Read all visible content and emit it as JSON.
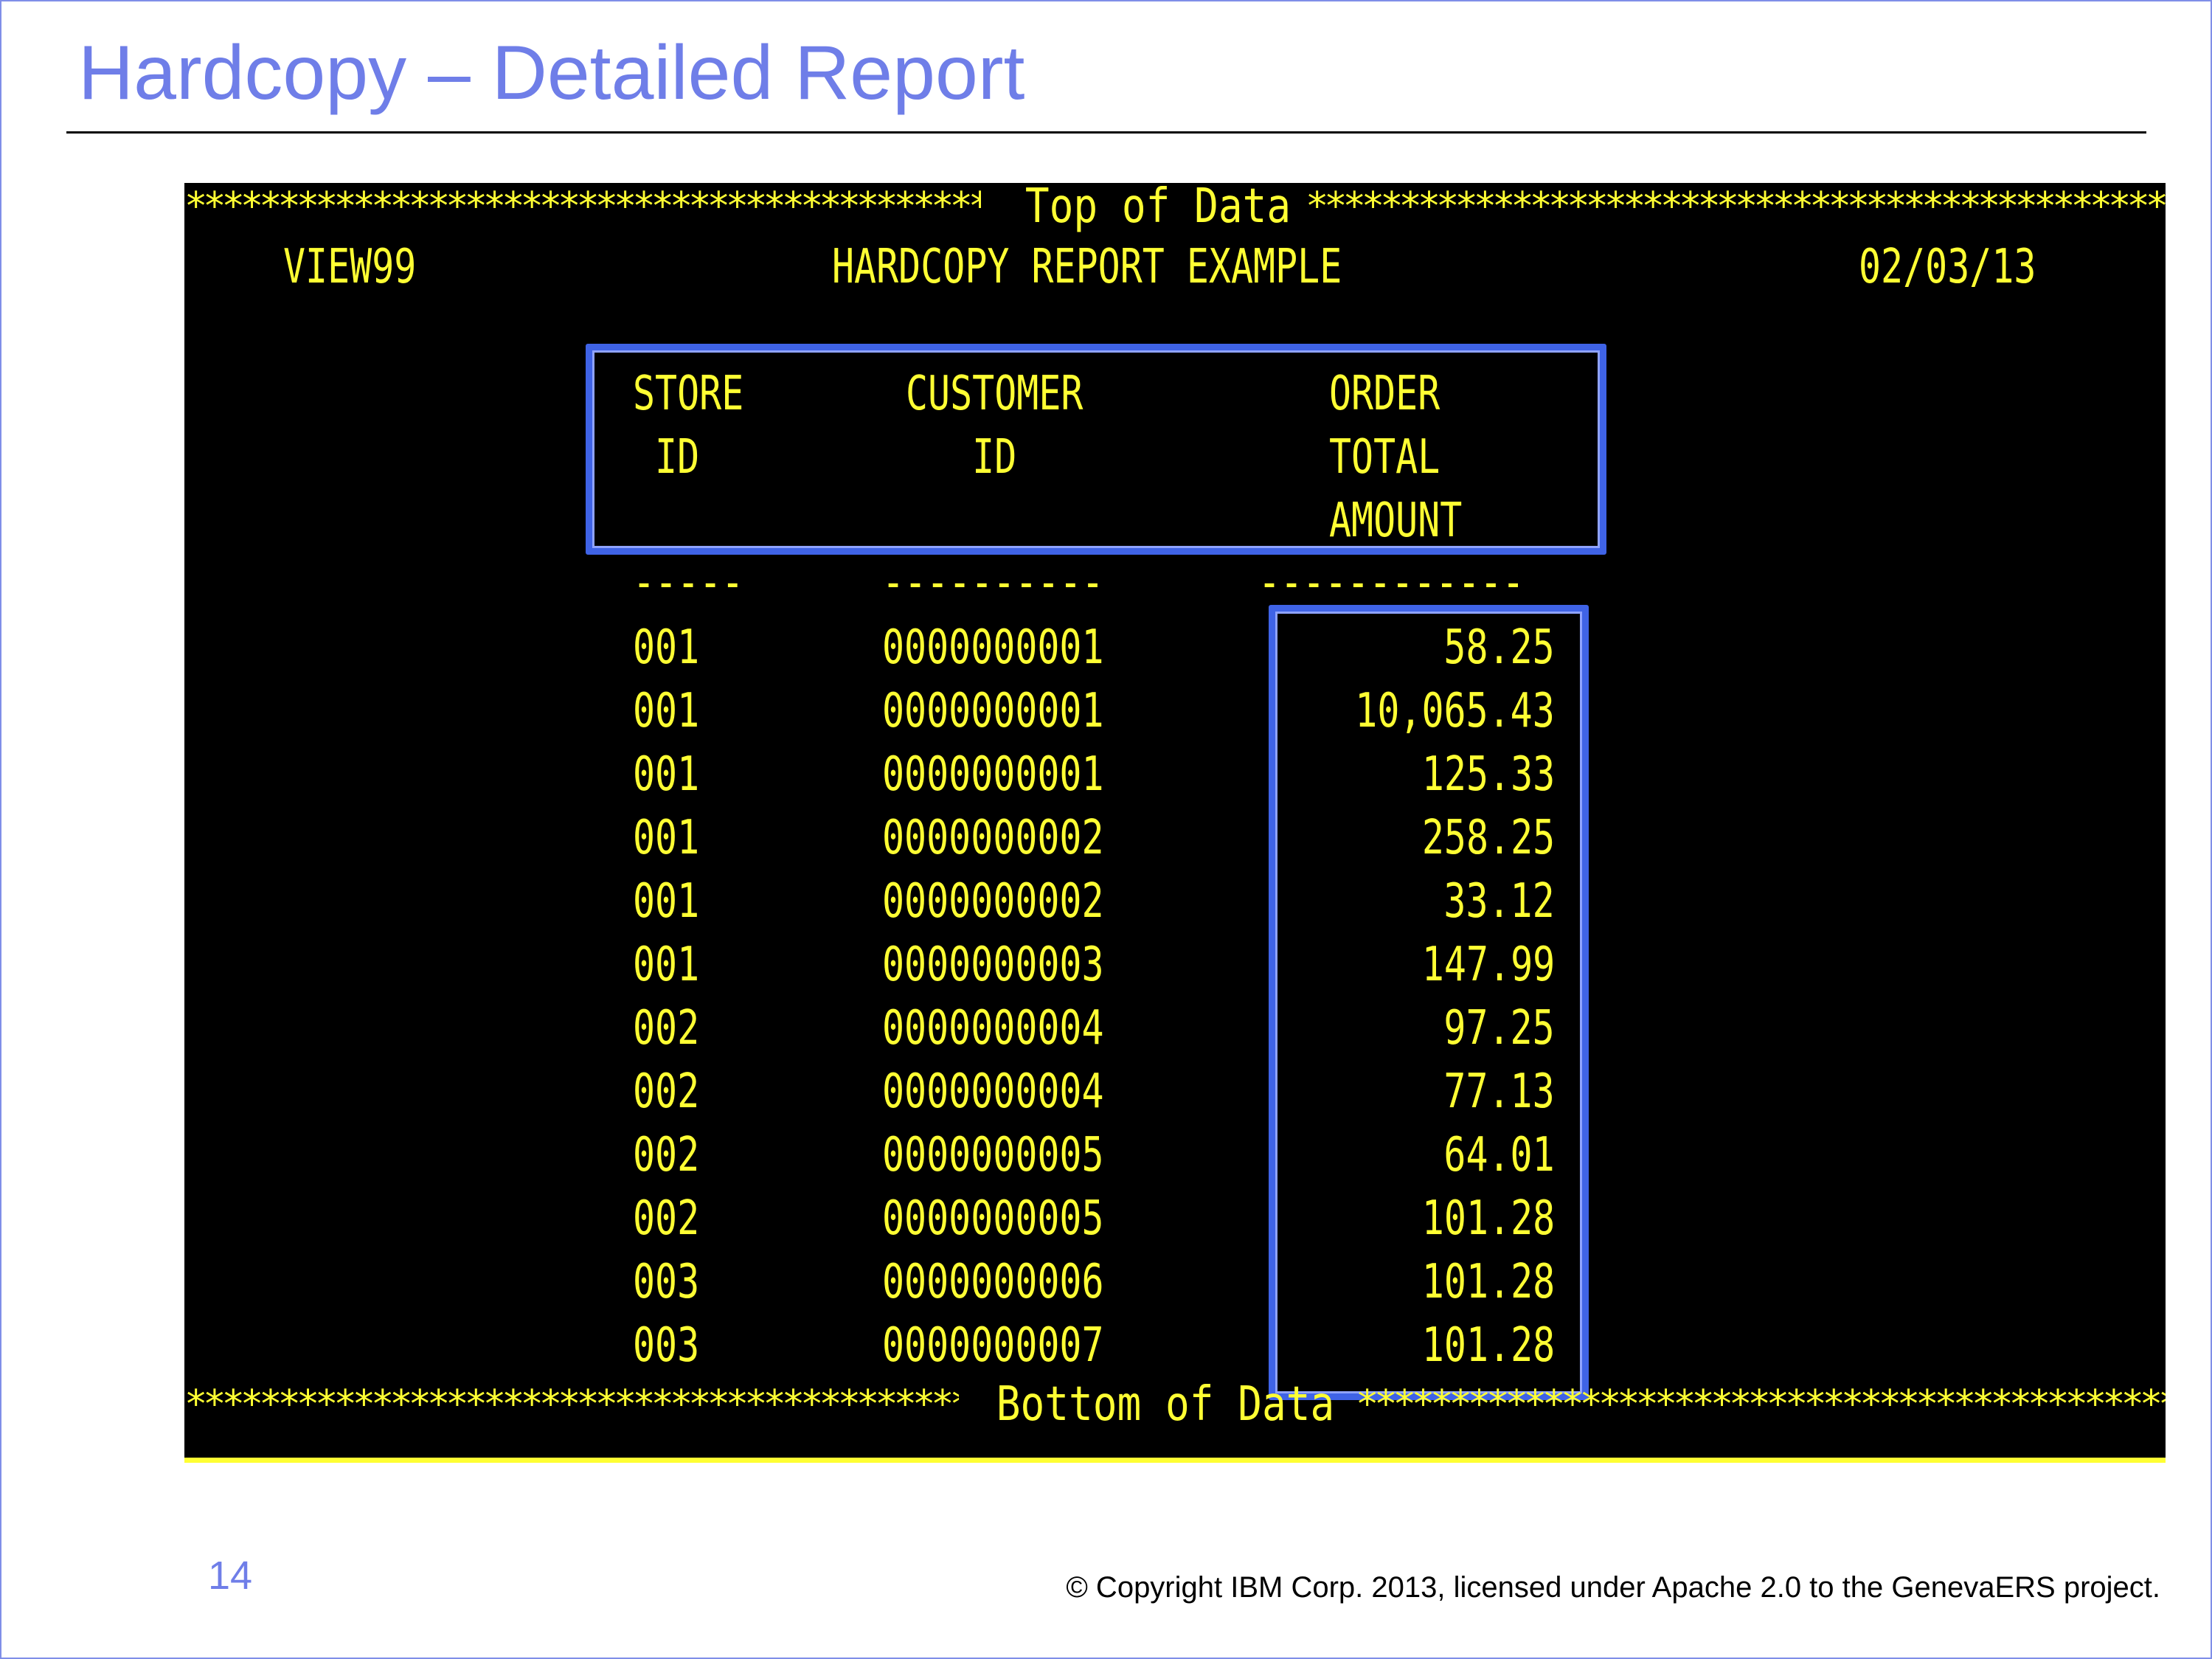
{
  "slide": {
    "title": "Hardcopy – Detailed Report",
    "page_number": "14",
    "copyright": "© Copyright IBM Corp. 2013, licensed under Apache 2.0 to the GenevaERS project."
  },
  "terminal": {
    "top_banner": "Top of Data",
    "bottom_banner": "Bottom of Data",
    "star_string": "***************************************************************************",
    "view_name": "VIEW99",
    "report_title": "HARDCOPY REPORT EXAMPLE",
    "report_date": "02/03/13",
    "headers": {
      "store": [
        "STORE",
        " ID"
      ],
      "customer": [
        "CUSTOMER",
        "   ID"
      ],
      "order": [
        "ORDER",
        "TOTAL",
        "AMOUNT"
      ]
    },
    "underlines": {
      "store": "-----",
      "customer": "----------",
      "order": "------------"
    },
    "rows": [
      {
        "store": "001",
        "customer": "0000000001",
        "amount": "58.25"
      },
      {
        "store": "001",
        "customer": "0000000001",
        "amount": "10,065.43"
      },
      {
        "store": "001",
        "customer": "0000000001",
        "amount": "125.33"
      },
      {
        "store": "001",
        "customer": "0000000002",
        "amount": "258.25"
      },
      {
        "store": "001",
        "customer": "0000000002",
        "amount": "33.12"
      },
      {
        "store": "001",
        "customer": "0000000003",
        "amount": "147.99"
      },
      {
        "store": "002",
        "customer": "0000000004",
        "amount": "97.25"
      },
      {
        "store": "002",
        "customer": "0000000004",
        "amount": "77.13"
      },
      {
        "store": "002",
        "customer": "0000000005",
        "amount": "64.01"
      },
      {
        "store": "002",
        "customer": "0000000005",
        "amount": "101.28"
      },
      {
        "store": "003",
        "customer": "0000000006",
        "amount": "101.28"
      },
      {
        "store": "003",
        "customer": "0000000007",
        "amount": "101.28"
      }
    ],
    "colors": {
      "screen_bg": "#000000",
      "text": "#ffff33",
      "highlight": "#3f63e6",
      "title": "#6f7ee8"
    }
  }
}
